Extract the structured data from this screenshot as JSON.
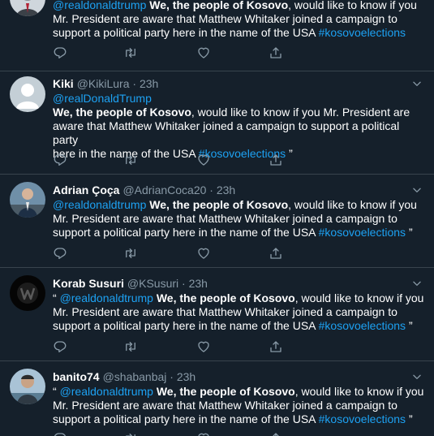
{
  "common": {
    "bold_phrase": "We, the people of Kosovo",
    "hashtag": "#kosovoelections",
    "quote_mark": "“",
    "close_quote": "”",
    "dot": "·"
  },
  "tweets": [
    {
      "mention": "@realdonaldtrump",
      "rest_line1": ", would like to know if you",
      "rest_line2": "Mr. President are aware that Matthew Whitaker joined a campaign to",
      "rest_line3": "support a political party here in the name of the USA "
    },
    {
      "name": "Kiki",
      "handle": "@KikiLura",
      "time": "23h",
      "mention": "@realDonaldTrump",
      "rest_line1": ", would like to know if you Mr. President are",
      "rest_line2": "aware that Matthew Whitaker joined a campaign to support a political party",
      "rest_line3": "here in the name of the USA "
    },
    {
      "name": "Adrian Çoça",
      "handle": "@AdrianCoca20",
      "time": "23h",
      "mention": "@realdonaldtrump",
      "rest_line1": ", would like to know if you",
      "rest_line2": "Mr. President are aware that Matthew Whitaker joined a campaign to",
      "rest_line3": "support a political party here in the name of the USA "
    },
    {
      "name": "Korab Susuri",
      "handle": "@KSusuri",
      "time": "23h",
      "mention": "@realdonaldtrump",
      "rest_line1": ", would like to know if you",
      "rest_line2": "Mr. President are aware that Matthew Whitaker joined a campaign to",
      "rest_line3": "support a political party here in the name of the USA "
    },
    {
      "name": "banito74",
      "handle": "@shabanbaj",
      "time": "23h",
      "mention": "@realdonaldtrump",
      "rest_line1": ", would like to know if you",
      "rest_line2": "Mr. President are aware that Matthew Whitaker joined a campaign to",
      "rest_line3": "support a political party here in the name of the USA "
    }
  ],
  "icons": {
    "reply": "reply-icon",
    "retweet": "retweet-icon",
    "like": "like-icon",
    "share": "share-icon",
    "caret": "chevron-down-icon"
  },
  "colors": {
    "background": "#15202b",
    "link": "#1da1f2",
    "secondary_text": "#8899a6",
    "divider": "#38444d"
  }
}
